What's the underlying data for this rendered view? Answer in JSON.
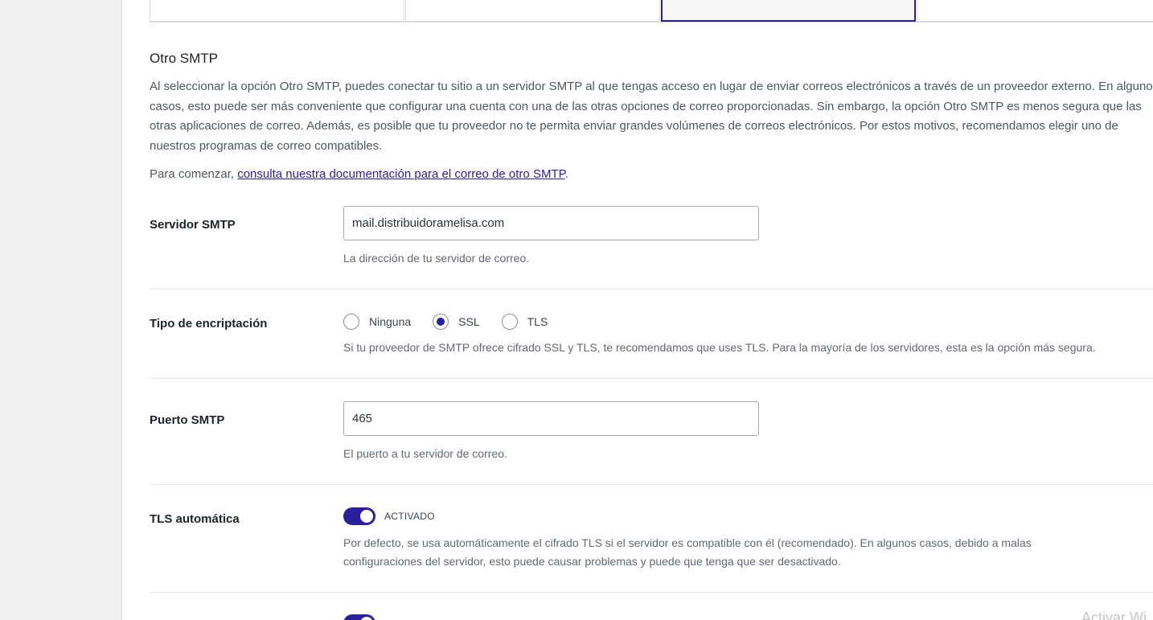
{
  "section": {
    "title": "Otro SMTP",
    "description": "Al seleccionar la opción Otro SMTP, puedes conectar tu sitio a un servidor SMTP al que tengas acceso en lugar de enviar correos electrónicos a través de un proveedor externo. En algunos casos, esto puede ser más conveniente que configurar una cuenta con una de las otras opciones de correo proporcionadas. Sin embargo, la opción Otro SMTP es menos segura que las otras aplicaciones de correo. Además, es posible que tu proveedor no te permita enviar grandes volúmenes de correos electrónicos. Por estos motivos, recomendamos elegir uno de nuestros programas de correo compatibles.",
    "getting_started_prefix": "Para comenzar, ",
    "getting_started_link": "consulta nuestra documentación para el correo de otro SMTP",
    "getting_started_suffix": "."
  },
  "smtp_host": {
    "label": "Servidor SMTP",
    "value": "mail.distribuidoramelisa.com",
    "help": "La dirección de tu servidor de correo."
  },
  "encryption": {
    "label": "Tipo de encriptación",
    "options": [
      "Ninguna",
      "SSL",
      "TLS"
    ],
    "selected": "SSL",
    "help": "Si tu proveedor de SMTP ofrece cifrado SSL y TLS, te recomendamos que uses TLS. Para la mayoría de los servidores, esta es la opción más segura."
  },
  "smtp_port": {
    "label": "Puerto SMTP",
    "value": "465",
    "help": "El puerto a tu servidor de correo."
  },
  "auto_tls": {
    "label": "TLS automática",
    "state": "ACTIVADO",
    "enabled": true,
    "help": "Por defecto, se usa automáticamente el cifrado TLS si el servidor es compatible con él (recomendado). En algunos casos, debido a malas configuraciones del servidor, esto puede causar problemas y puede que tenga que ser desactivado."
  },
  "watermark": "Activar Wi",
  "colors": {
    "accent": "#2a1f9d",
    "page_bg": "#f0f0f1",
    "panel_bg": "#ffffff"
  }
}
